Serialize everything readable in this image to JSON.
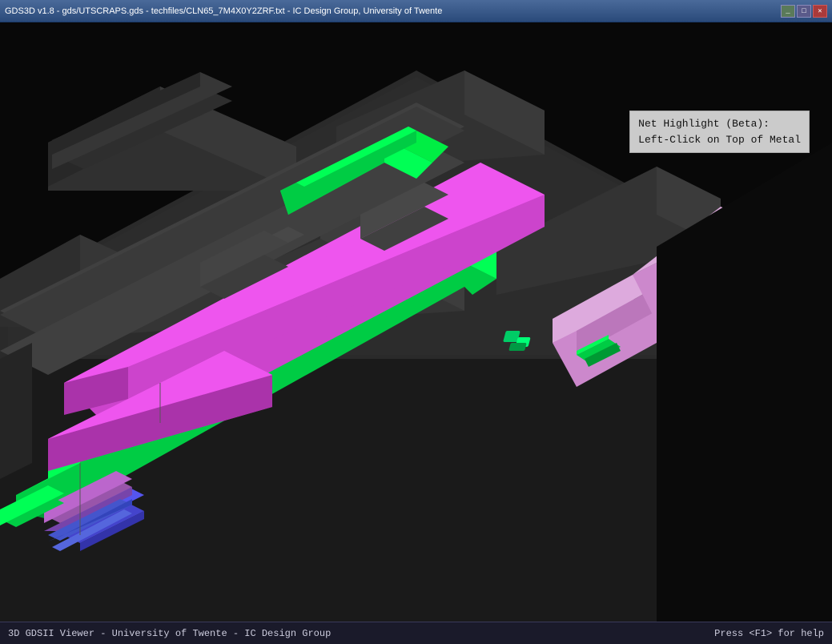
{
  "titleBar": {
    "title": "GDS3D v1.8 - gds/UTSCRAPS.gds - techfiles/CLN65_7M4X0Y2ZRF.txt - IC Design Group, University of Twente",
    "minimizeLabel": "_",
    "maximizeLabel": "□",
    "closeLabel": "✕"
  },
  "viewport": {
    "netHighlight": {
      "line1": "Net Highlight (Beta):",
      "line2": "Left-Click on Top of Metal"
    }
  },
  "statusBar": {
    "leftText": "3D GDSII Viewer - University of Twente - IC Design Group",
    "rightText": "Press <F1> for help"
  }
}
